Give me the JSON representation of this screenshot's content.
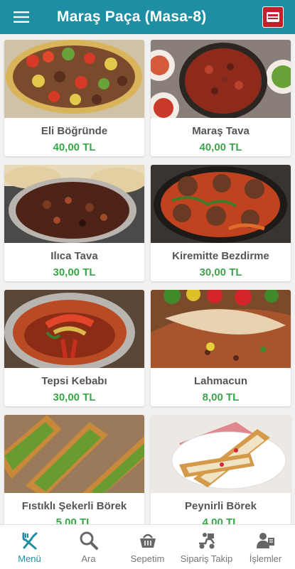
{
  "header": {
    "title": "Maraş Paça (Masa-8)",
    "logo_icon": "restaurant-logo-icon"
  },
  "menu_items": [
    {
      "name": "Eli Böğründe",
      "price": "40,00 TL"
    },
    {
      "name": "Maraş Tava",
      "price": "40,00 TL"
    },
    {
      "name": "Ilıca Tava",
      "price": "30,00 TL"
    },
    {
      "name": "Kiremitte Bezdirme",
      "price": "30,00 TL"
    },
    {
      "name": "Tepsi Kebabı",
      "price": "30,00 TL"
    },
    {
      "name": "Lahmacun",
      "price": "8,00 TL"
    },
    {
      "name": "Fıstıklı Şekerli Börek",
      "price": "5,00 TL"
    },
    {
      "name": "Peynirli Börek",
      "price": "4,00 TL"
    }
  ],
  "tabs": [
    {
      "label": "Menü",
      "icon": "fork-knife-icon",
      "active": true
    },
    {
      "label": "Ara",
      "icon": "search-icon"
    },
    {
      "label": "Sepetim",
      "icon": "basket-icon"
    },
    {
      "label": "Sipariş Takip",
      "icon": "delivery-icon"
    },
    {
      "label": "İşlemler",
      "icon": "user-actions-icon"
    }
  ],
  "colors": {
    "primary": "#1e8fa3",
    "price": "#3aa64a"
  }
}
